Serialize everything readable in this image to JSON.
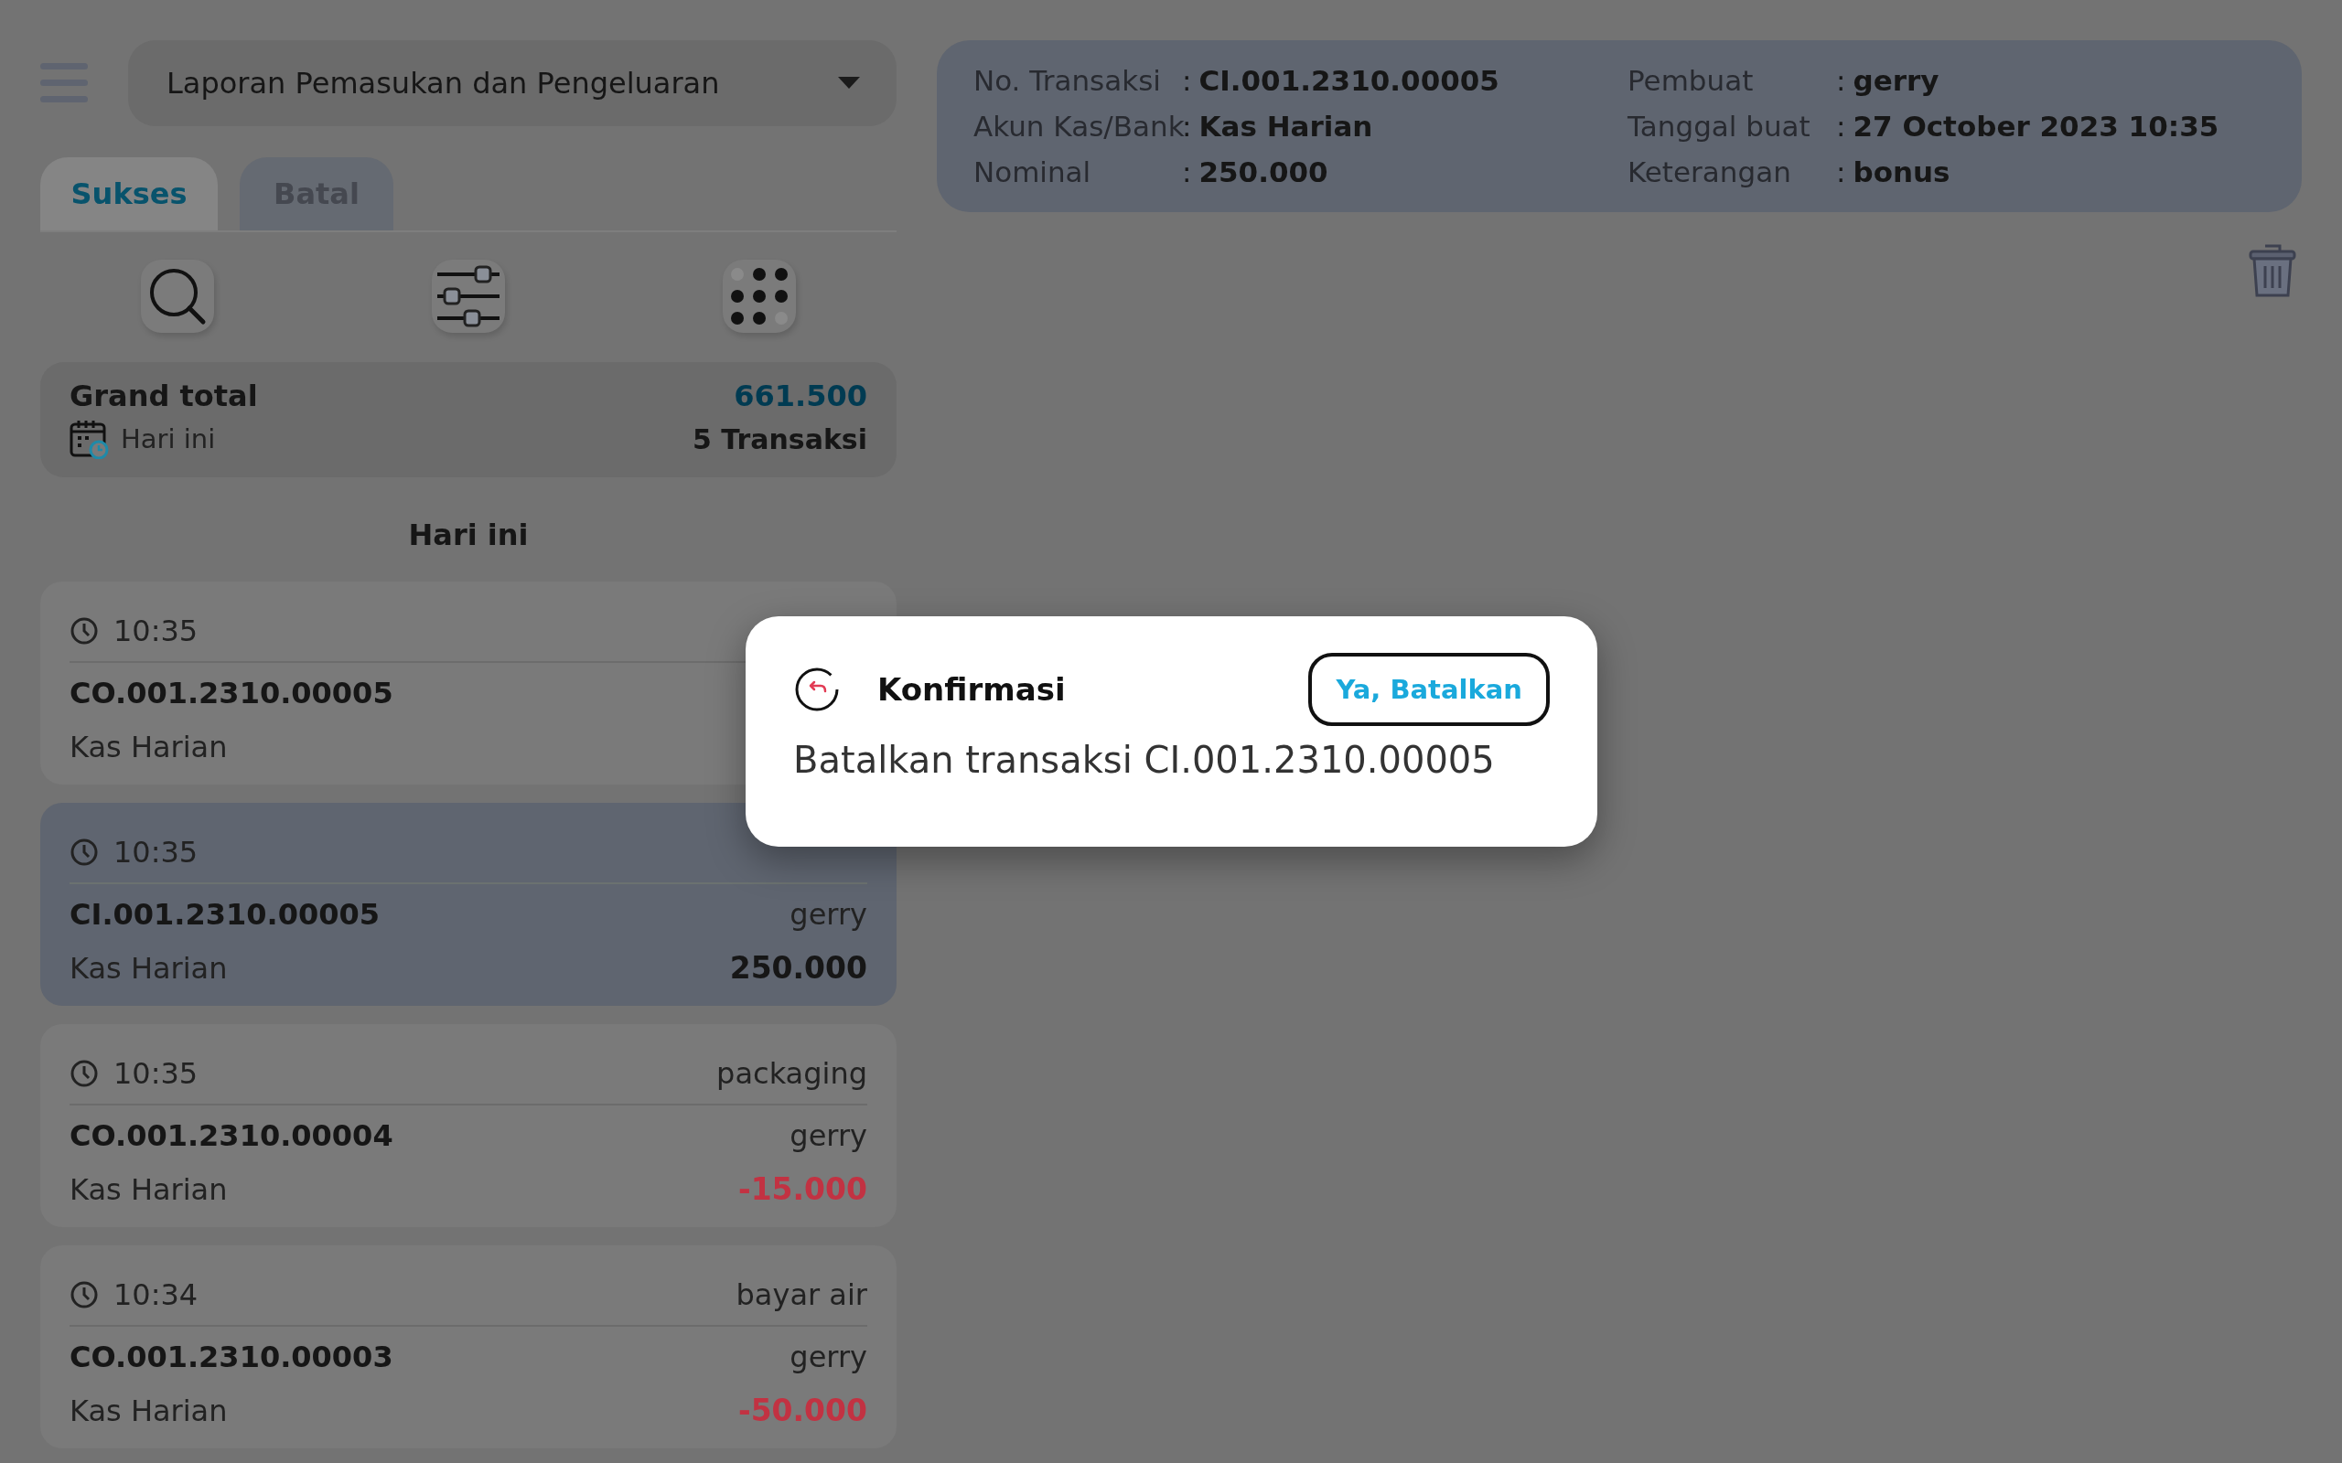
{
  "report_select": {
    "value": "Laporan Pemasukan dan Pengeluaran"
  },
  "tabs": [
    {
      "label": "Sukses",
      "selected": true
    },
    {
      "label": "Batal",
      "selected": false
    }
  ],
  "summary": {
    "title": "Grand total",
    "total": "661.500",
    "period": "Hari ini",
    "count": "5 Transaksi"
  },
  "group_header": "Hari ini",
  "transactions": [
    {
      "time": "10:35",
      "number": "CO.001.2310.00005",
      "account": "Kas Harian",
      "selected": false
    },
    {
      "time": "10:35",
      "number": "CI.001.2310.00005",
      "creator": "gerry",
      "account": "Kas Harian",
      "amount": "250.000",
      "kind": "income",
      "selected": true
    },
    {
      "time": "10:35",
      "description": "packaging",
      "number": "CO.001.2310.00004",
      "creator": "gerry",
      "account": "Kas Harian",
      "amount": "-15.000",
      "kind": "expense",
      "selected": false
    },
    {
      "time": "10:34",
      "description": "bayar air",
      "number": "CO.001.2310.00003",
      "creator": "gerry",
      "account": "Kas Harian",
      "amount": "-50.000",
      "kind": "expense",
      "selected": false
    }
  ],
  "detail": {
    "left": [
      {
        "label": "No. Transaksi",
        "separator": ":",
        "value": "CI.001.2310.00005"
      },
      {
        "label": "Akun Kas/Bank",
        "separator": ":",
        "value": "Kas Harian"
      },
      {
        "label": "Nominal",
        "separator": ":",
        "value": "250.000"
      }
    ],
    "right": [
      {
        "label": "Pembuat",
        "separator": ":",
        "value": "gerry"
      },
      {
        "label": "Tanggal buat",
        "separator": ":",
        "value": "27 October 2023 10:35"
      },
      {
        "label": "Keterangan",
        "separator": ":",
        "value": "bonus"
      }
    ]
  },
  "dialog": {
    "title": "Konfirmasi",
    "message": "Batalkan transaksi CI.001.2310.00005",
    "confirm_button": "Ya, Batalkan"
  }
}
